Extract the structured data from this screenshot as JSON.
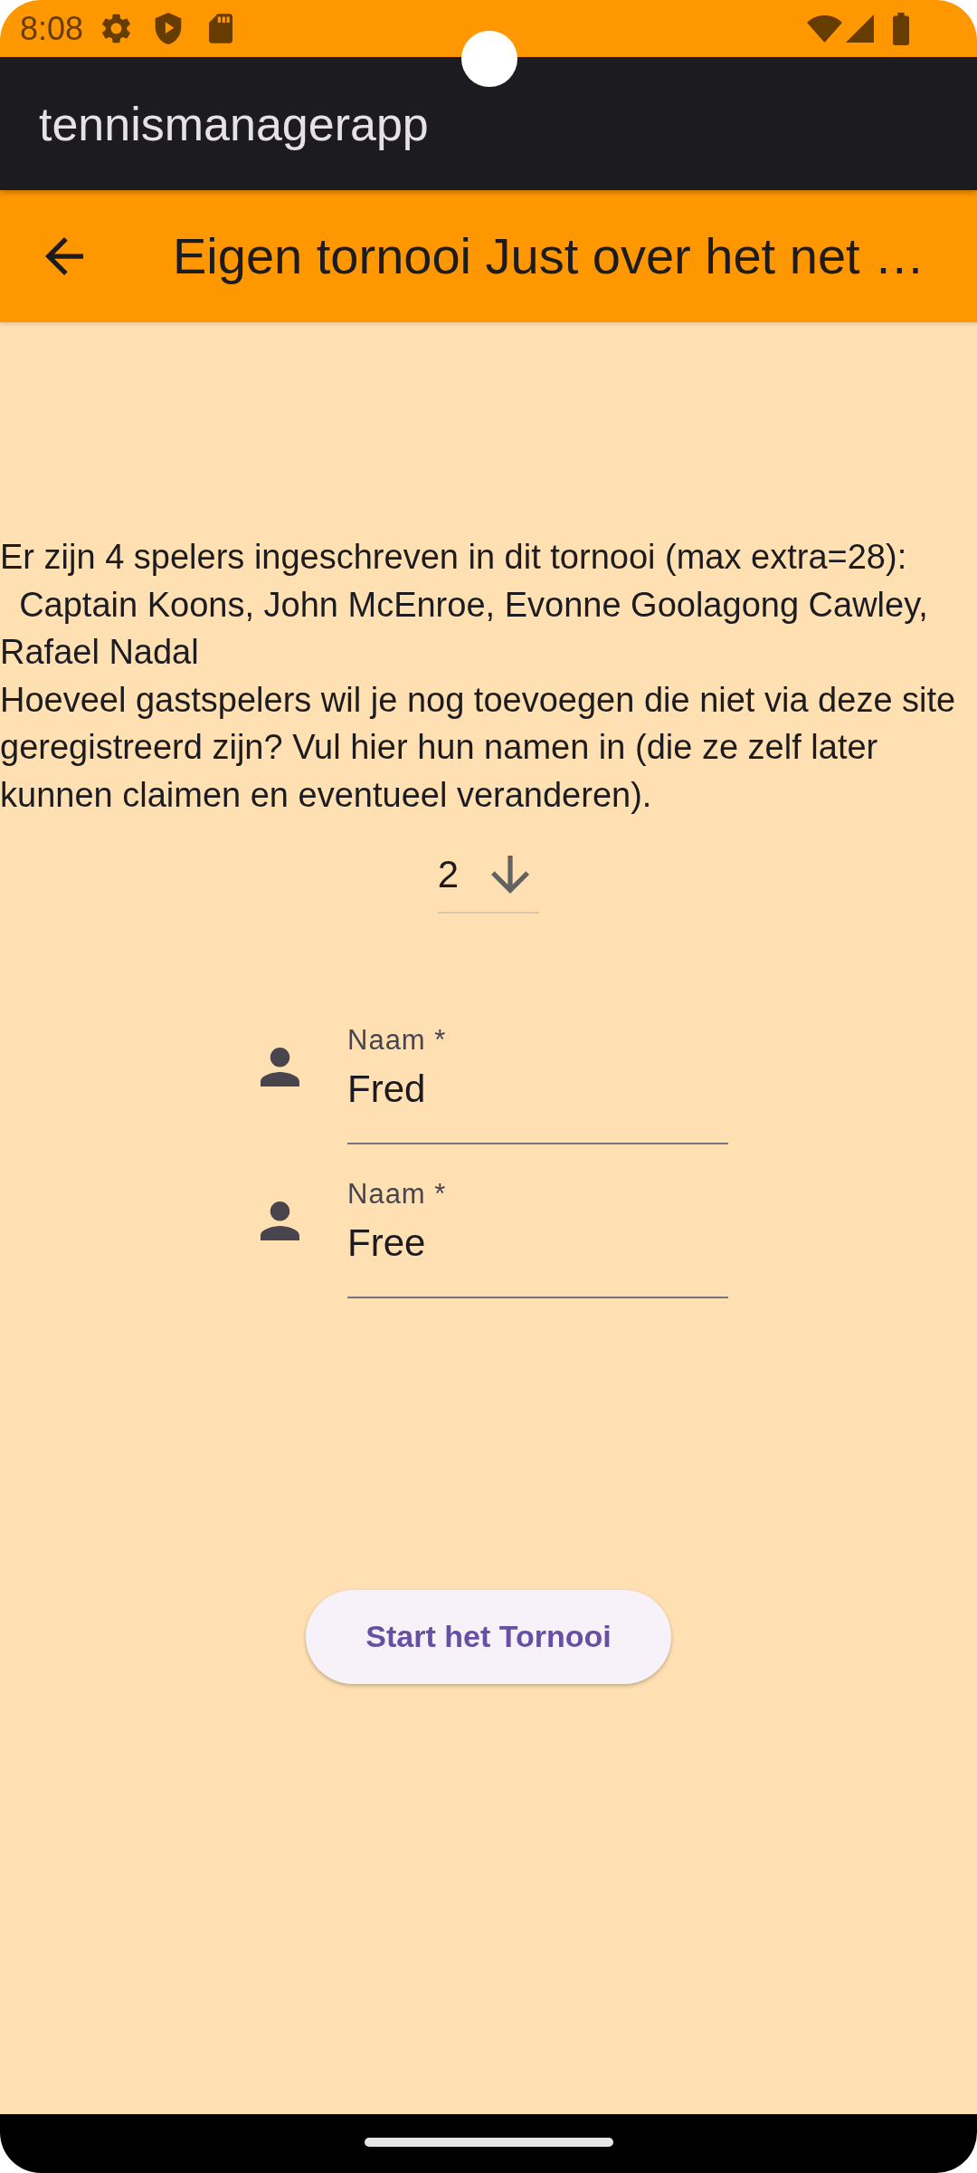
{
  "status_bar": {
    "time": "8:08"
  },
  "app_bar": {
    "title": "tennismanagerapp"
  },
  "page_header": {
    "title": "Eigen tornooi Just over het net …"
  },
  "intro": {
    "text": "Er zijn 4 spelers ingeschreven in dit tornooi (max extra=28):\n  Captain Koons, John McEnroe, Evonne Goolagong Cawley, Rafael Nadal\nHoeveel gastspelers wil je nog toevoegen die niet via deze site geregistreerd zijn? Vul hier hun namen in (die ze zelf later kunnen claimen en eventueel veranderen)."
  },
  "guest_count": {
    "value": "2"
  },
  "guest_fields": [
    {
      "label": "Naam *",
      "value": "Fred"
    },
    {
      "label": "Naam *",
      "value": "Free"
    }
  ],
  "start_button": {
    "label": "Start het Tornooi"
  }
}
